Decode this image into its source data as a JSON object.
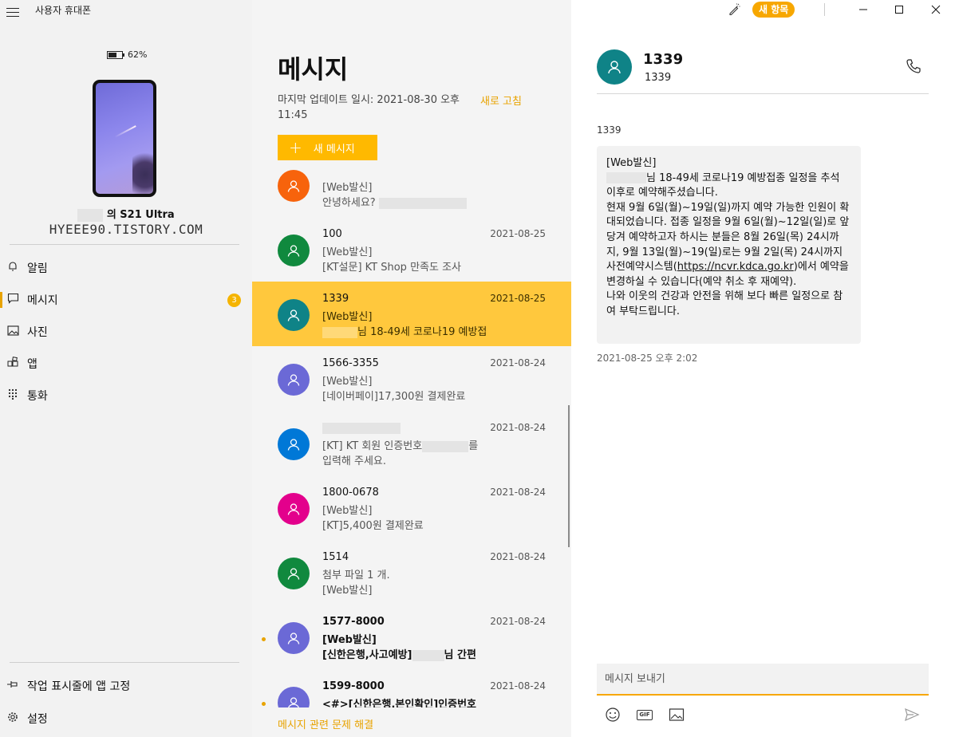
{
  "app": {
    "title": "사용자 휴대폰"
  },
  "phone": {
    "battery_percent": "62%",
    "battery_level": 0.62,
    "device_name_suffix": "의 S21 Ultra",
    "watermark": "HYEEE90.TISTORY.COM"
  },
  "nav": {
    "items": [
      {
        "label": "알림",
        "icon": "bell-icon"
      },
      {
        "label": "메시지",
        "icon": "chat-icon",
        "badge": "3"
      },
      {
        "label": "사진",
        "icon": "photo-icon"
      },
      {
        "label": "앱",
        "icon": "apps-icon"
      },
      {
        "label": "통화",
        "icon": "dialpad-icon"
      }
    ],
    "pin_label": "작업 표시줄에 앱 고정",
    "settings_label": "설정"
  },
  "messages": {
    "title": "메시지",
    "last_update": "마지막 업데이트 일시: 2021-08-30 오후 11:45",
    "refresh_label": "새로 고침",
    "new_message_label": "새 메시지",
    "troubleshoot_label": "메시지 관련 문제 해결",
    "conversations": [
      {
        "name": "",
        "date": "",
        "line1": "[Web발신]",
        "line2": "안녕하세요?",
        "color": "#f7630c"
      },
      {
        "name": "100",
        "date": "2021-08-25",
        "line1": "[Web발신]",
        "line2": "[KT설문] KT Shop 만족도 조사",
        "color": "#10893e"
      },
      {
        "name": "1339",
        "date": "2021-08-25",
        "line1": "[Web발신]",
        "line2": "님 18-49세 코로나19 예방접",
        "color": "#0f8387",
        "selected": true
      },
      {
        "name": "1566-3355",
        "date": "2021-08-24",
        "line1": "[Web발신]",
        "line2": "[네이버페이]17,300원 결제완료",
        "color": "#6b69d6"
      },
      {
        "name": "",
        "date": "2021-08-24",
        "line1": "[KT] KT 회원 인증번호",
        "line1_suffix": "를",
        "line2": "입력해 주세요.",
        "color": "#0078d7"
      },
      {
        "name": "1800-0678",
        "date": "2021-08-24",
        "line1": "[Web발신]",
        "line2": "[KT]5,400원 결제완료",
        "color": "#e3008c"
      },
      {
        "name": "1514",
        "date": "2021-08-24",
        "line1": "첨부 파일 1 개.",
        "line2": "[Web발신]",
        "color": "#10893e"
      },
      {
        "name": "1577-8000",
        "date": "2021-08-24",
        "line1": "[Web발신]",
        "line2": "[신한은행,사고예방]",
        "line2_suffix": "님 간편",
        "color": "#6b69d6",
        "unread": true
      },
      {
        "name": "1599-8000",
        "date": "2021-08-24",
        "line1": "<#>[신한은행,본인확인]인증번호",
        "line2": "",
        "color": "#6b69d6",
        "unread": true
      }
    ]
  },
  "thread": {
    "toolbar": {
      "new_items_label": "새 항목"
    },
    "contact_name": "1339",
    "contact_number": "1339",
    "sender_label": "1339",
    "message": {
      "p1": "[Web발신]",
      "p2_suffix": "님 18-49세 코로나19 예방접종 일정을 추석 이후로 예약해주셨습니다.",
      "p3": "현재 9월 6일(월)~19일(일)까지 예약 가능한 인원이 확대되었습니다. 접종 일정을 9월 6일(월)~12일(일)로 앞당겨 예약하고자 하시는 분들은 8월 26일(목) 24시까지, 9월 13일(월)~19(일)로는 9월 2일(목) 24시까지 사전예약시스템(",
      "link": "https://ncvr.kdca.go.kr",
      "p3_end": ")에서 예약을 변경하실 수 있습니다(예약 취소 후 재예약).",
      "p4": "나와 이웃의 건강과 안전을 위해 보다 빠른 일정으로 참여 부탁드립니다."
    },
    "timestamp": "2021-08-25 오후 2:02",
    "compose_placeholder": "메시지 보내기",
    "accent": "#f7a700"
  }
}
